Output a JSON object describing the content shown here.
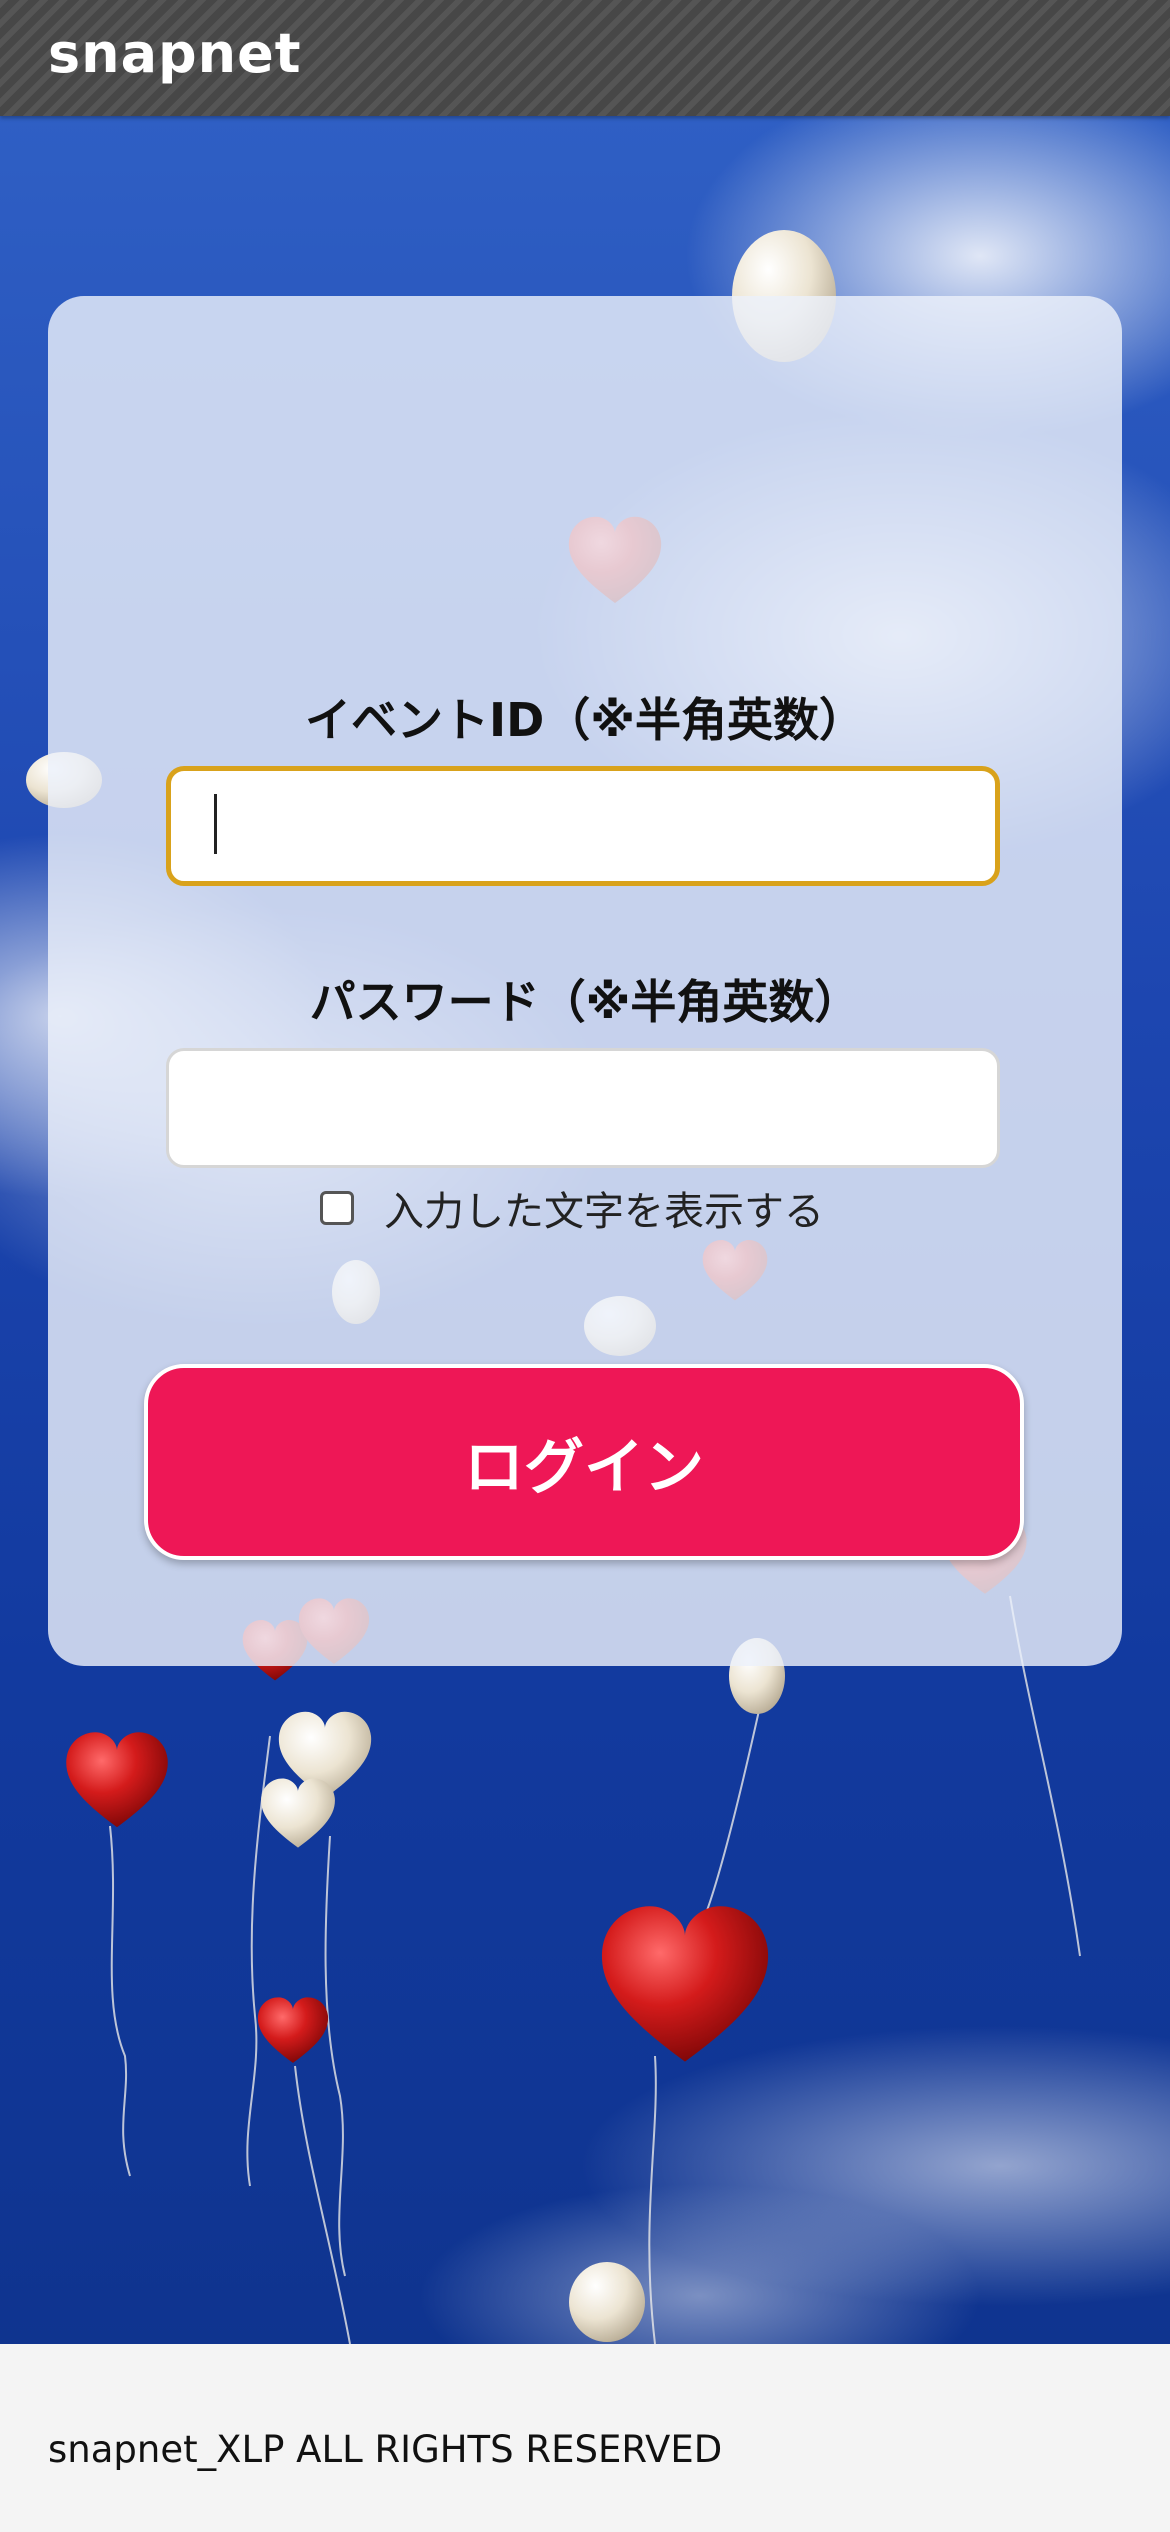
{
  "header": {
    "brand": "snapnet"
  },
  "login_form": {
    "event_id_label": "イベントID（※半角英数）",
    "event_id_value": "",
    "password_label": "パスワード（※半角英数）",
    "password_value": "",
    "show_chars_label": "入力した文字を表示する",
    "show_chars_checked": false,
    "login_button_label": "ログイン"
  },
  "footer": {
    "copyright": "snapnet_XLP ALL RIGHTS RESERVED"
  },
  "colors": {
    "header_bg": "#4a4a4a",
    "focus_border": "#d9a21b",
    "login_button": "#ee1756",
    "sky": "#1d46b0",
    "balloon_red": "#d41b1b",
    "balloon_white": "#efe9dc"
  },
  "background": {
    "description_icon": "heart-balloons-sky-image"
  }
}
